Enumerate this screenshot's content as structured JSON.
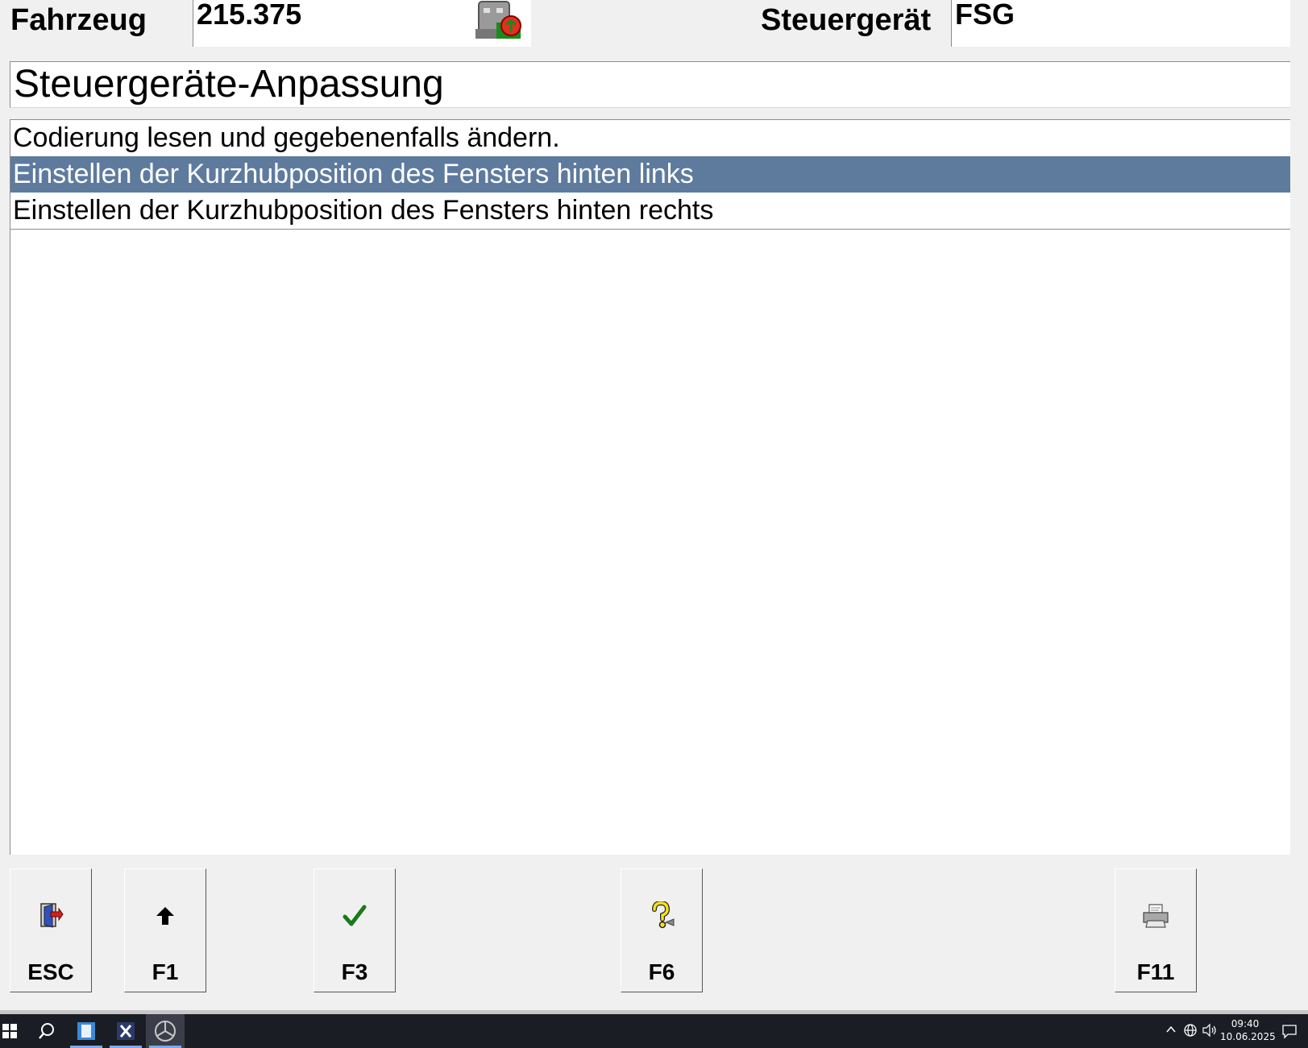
{
  "header": {
    "vehicle_label": "Fahrzeug",
    "vehicle_value": "215.375",
    "ecu_label": "Steuergerät",
    "ecu_value": "FSG",
    "status_icon": "ecu-status-icon"
  },
  "title": "Steuergeräte-Anpassung",
  "list": {
    "items": [
      {
        "label": "Codierung lesen und gegebenenfalls ändern.",
        "selected": false
      },
      {
        "label": "Einstellen der Kurzhubposition des Fensters hinten links",
        "selected": true
      },
      {
        "label": "Einstellen der Kurzhubposition des Fensters hinten rechts",
        "selected": false
      }
    ],
    "selected_color": "#5e7b9e"
  },
  "fkeys": [
    {
      "key": "ESC",
      "icon": "exit-door-icon"
    },
    {
      "key": "F1",
      "icon": "arrow-up-icon"
    },
    {
      "key": "F3",
      "icon": "checkmark-icon"
    },
    {
      "key": "F6",
      "icon": "help-icon"
    },
    {
      "key": "F11",
      "icon": "printer-icon"
    }
  ],
  "taskbar": {
    "time": "09:40",
    "date": "10.06.2025"
  }
}
